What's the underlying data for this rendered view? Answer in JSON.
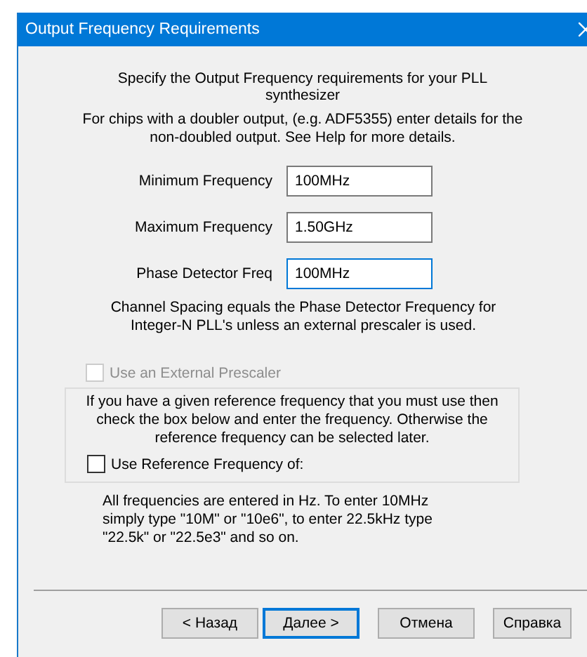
{
  "window": {
    "title": "Output Frequency Requirements"
  },
  "intro": [
    "Specify the Output Frequency requirements for your PLL synthesizer",
    "For chips with a doubler output, (e.g. ADF5355) enter details for the non-doubled output. See Help for more details."
  ],
  "fields": [
    {
      "label": "Minimum Frequency",
      "value": "100MHz",
      "focused": false
    },
    {
      "label": "Maximum Frequency",
      "value": "1.50GHz",
      "focused": false
    },
    {
      "label": "Phase Detector Freq",
      "value": "100MHz",
      "focused": true
    }
  ],
  "spacing_note": "Channel Spacing equals the Phase Detector Frequency for Integer-N PLL's unless an external prescaler is used.",
  "prescaler": {
    "label": "Use an External Prescaler",
    "checked": false,
    "disabled": true
  },
  "reference_group": {
    "text": "If you have a given reference frequency that you must use then check the box below and enter the frequency.   Otherwise the reference frequency can be selected later.",
    "checkbox": {
      "label": "Use Reference Frequency of:",
      "checked": false,
      "disabled": false
    }
  },
  "hint": "All frequencies are entered in Hz.   To enter 10MHz simply type \"10M\" or \"10e6\",  to enter 22.5kHz type \"22.5k\" or \"22.5e3\" and so on.",
  "buttons": [
    {
      "label": "< Назад",
      "default": false
    },
    {
      "label": "Далее >",
      "default": true
    },
    {
      "label": "Отмена",
      "default": false
    },
    {
      "label": "Справка",
      "default": false
    }
  ]
}
